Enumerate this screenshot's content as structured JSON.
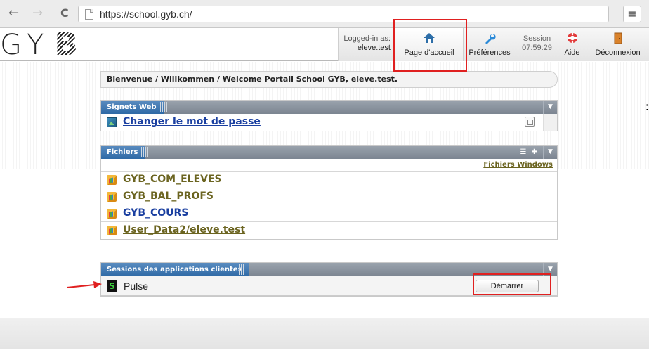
{
  "browser": {
    "back_glyph": "←",
    "forward_glyph": "→",
    "reload_glyph": "C",
    "url": "https://school.gyb.ch/",
    "menu_glyph": "≡"
  },
  "header": {
    "logo_text": "GY",
    "logo_b": "B",
    "logged_in_label": "Logged-in as:",
    "logged_in_user": "eleve.test",
    "home_label": "Page d'accueil",
    "prefs_label": "Préférences",
    "session_label": "Session",
    "session_time": "07:59:29",
    "help_label": "Aide",
    "logout_label": "Déconnexion",
    "icons": {
      "home": "house-icon",
      "prefs": "wrench-icon",
      "help": "lifebuoy-icon",
      "logout": "door-icon"
    }
  },
  "welcome_text": "Bienvenue / Willkommen / Welcome Portail School GYB, eleve.test.",
  "bookmarks": {
    "title": "Signets Web",
    "items": [
      {
        "label": "Changer le mot de passe"
      }
    ]
  },
  "files": {
    "title": "Fichiers",
    "windows_link": "Fichiers Windows",
    "items": [
      {
        "label": "GYB_COM_ELEVES"
      },
      {
        "label": "GYB_BAL_PROFS"
      },
      {
        "label": "GYB_COURS"
      },
      {
        "label": "User_Data2/eleve.test"
      }
    ]
  },
  "sessions": {
    "title": "Sessions des applications clientes",
    "items": [
      {
        "label": "Pulse",
        "action": "Démarrer"
      }
    ]
  },
  "colors": {
    "link_blue": "#1a3fa0",
    "link_olive": "#6b6420",
    "annotation_red": "#e02020"
  }
}
